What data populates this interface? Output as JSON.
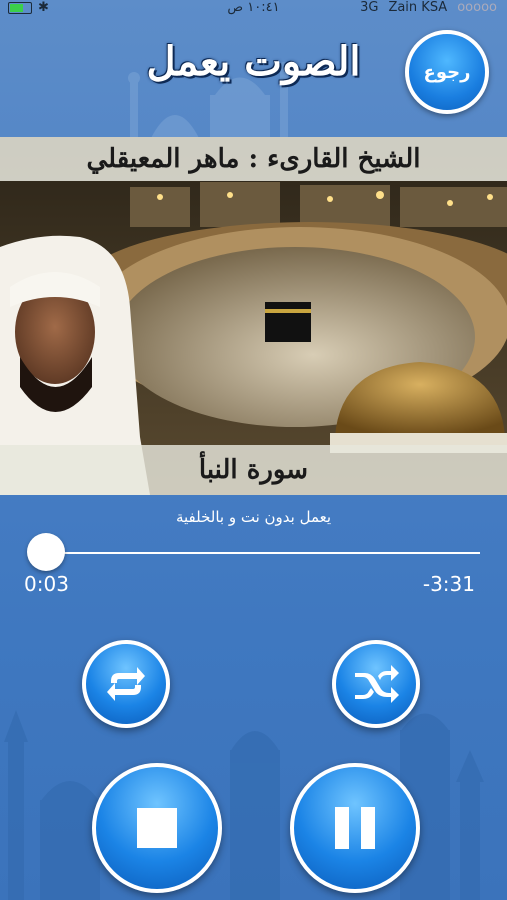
{
  "status_bar": {
    "time": "١٠:٤١ ص",
    "network": "3G",
    "carrier": "Zain KSA",
    "signal": "ooooo"
  },
  "header": {
    "title": "الصوت يعمل",
    "back_label": "رجوع"
  },
  "banner": {
    "reciter": "الشيخ القارىء : ماهر المعيقلي",
    "surah": "سورة النبأ"
  },
  "player": {
    "caption": "يعمل بدون نت و بالخلفية",
    "elapsed": "0:03",
    "remaining": "-3:31",
    "progress_fraction": 0.014
  },
  "controls": {
    "repeat": "repeat-icon",
    "shuffle": "shuffle-icon",
    "stop": "stop-icon",
    "pause": "pause-icon"
  },
  "colors": {
    "background": "#4a7fc4",
    "button_blue": "#1b84e6",
    "text": "#ffffff"
  }
}
